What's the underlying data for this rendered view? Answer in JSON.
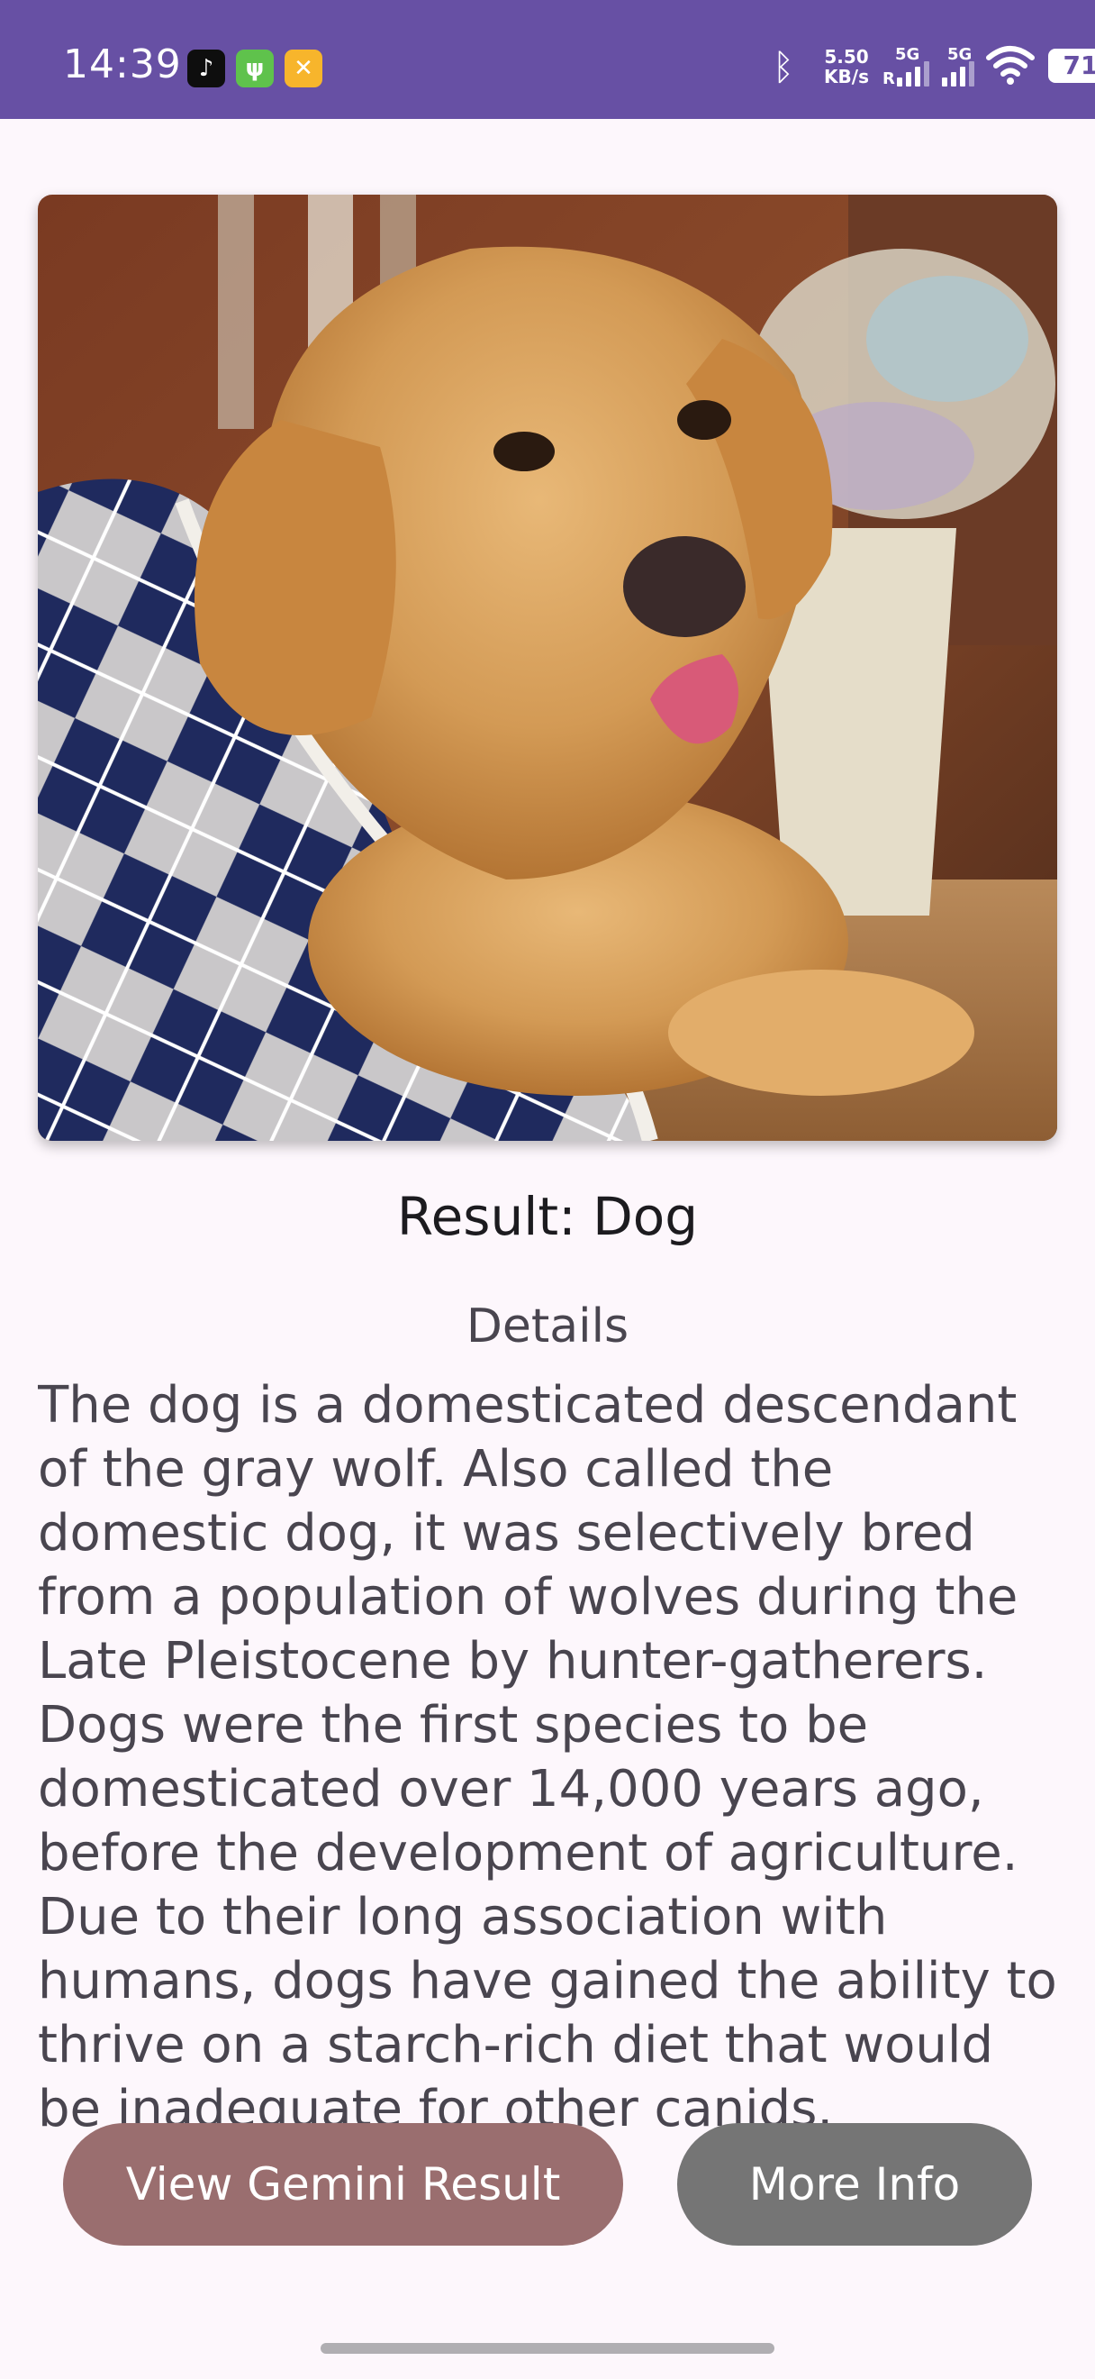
{
  "status_bar": {
    "time": "14:39",
    "apps": [
      "tiktok-icon",
      "usb-icon",
      "tools-icon"
    ],
    "net_speed_value": "5.50",
    "net_speed_unit": "KB/s",
    "signal_1_label": "5G",
    "signal_1_prefix": "R",
    "signal_2_label": "5G",
    "battery_level": "71",
    "color": "#6750a4"
  },
  "photo": {
    "subject": "golden retriever wearing a navy and white argyle sweater"
  },
  "result": {
    "title": "Result: Dog"
  },
  "details": {
    "label": "Details",
    "body": "The dog is a domesticated descendant of the gray wolf. Also called the domestic dog, it was selectively bred from a population of wolves during the Late Pleistocene by hunter-gatherers. Dogs were the first species to be domesticated over 14,000 years ago, before the development of agriculture. Due to their long association with humans, dogs have gained the ability to thrive on a starch-rich diet that would be inadequate for other canids."
  },
  "buttons": {
    "gemini_label": "View Gemini Result",
    "gemini_color": "#9a6e6f",
    "more_label": "More Info",
    "more_color": "#757575"
  }
}
